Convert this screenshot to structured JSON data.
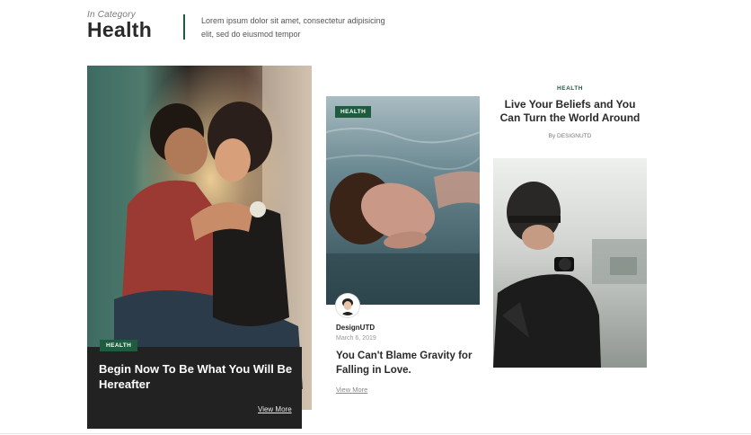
{
  "header": {
    "in_category": "In Category",
    "title": "Health",
    "description": "Lorem ipsum dolor sit amet, consectetur adipisicing elit, sed do eiusmod tempor"
  },
  "posts": [
    {
      "badge": "HEALTH",
      "title": "Begin Now To Be What You Will Be Hereafter",
      "view_more": "View More"
    },
    {
      "badge": "HEALTH",
      "author": "DesignUTD",
      "date": "March 6, 2019",
      "title": "You Can't Blame Gravity for Falling in Love.",
      "view_more": "View More"
    },
    {
      "category": "HEALTH",
      "title": "Live Your Beliefs and You Can Turn the World Around",
      "byline": "By DESIGNUTD"
    }
  ],
  "colors": {
    "accent": "#1f5b3e",
    "dark_box": "#222222"
  }
}
